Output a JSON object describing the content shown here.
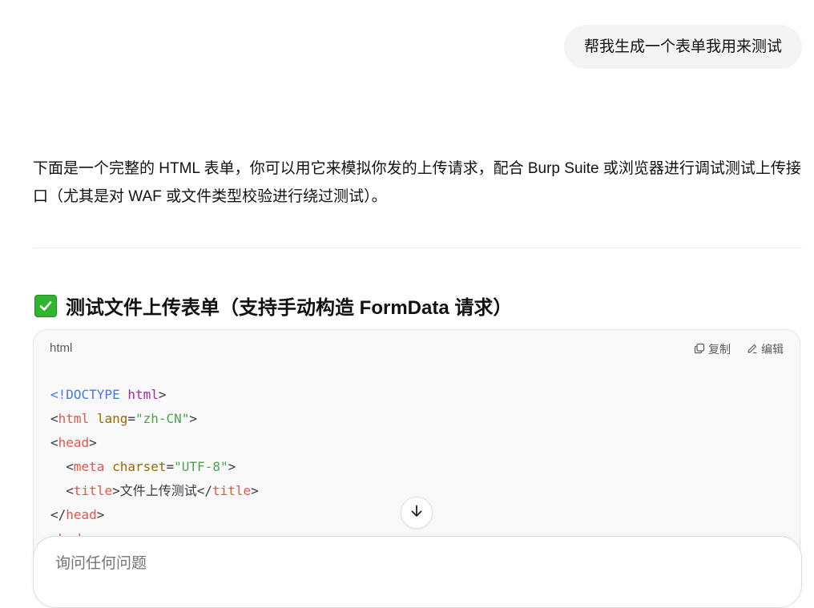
{
  "user_message": "帮我生成一个表单我用来测试",
  "answer": {
    "intro": "下面是一个完整的 HTML 表单，你可以用它来模拟你发的上传请求，配合 Burp Suite 或浏览器进行调试测试上传接口（尤其是对 WAF 或文件类型校验进行绕过测试）。",
    "heading": "测试文件上传表单（支持手动构造 FormData 请求）",
    "heading_icon": "check-mark-icon"
  },
  "code_block": {
    "language": "html",
    "copy_label": "复制",
    "edit_label": "编辑",
    "lines": {
      "l1_a": "<!DOCTYPE",
      "l1_b": "html",
      "l2_tag": "html",
      "l2_attr": "lang",
      "l2_val": "\"zh-CN\"",
      "l3_tag": "head",
      "l4_tag": "meta",
      "l4_attr": "charset",
      "l4_val": "\"UTF-8\"",
      "l5_tag": "title",
      "l5_text": "文件上传测试",
      "l6_tag": "head",
      "l7_tag": "body"
    }
  },
  "composer": {
    "placeholder": "询问任何问题"
  },
  "colors": {
    "bubble_bg": "#f4f4f4",
    "code_bg": "#f9f9f9",
    "check_green": "#2fb52f"
  }
}
